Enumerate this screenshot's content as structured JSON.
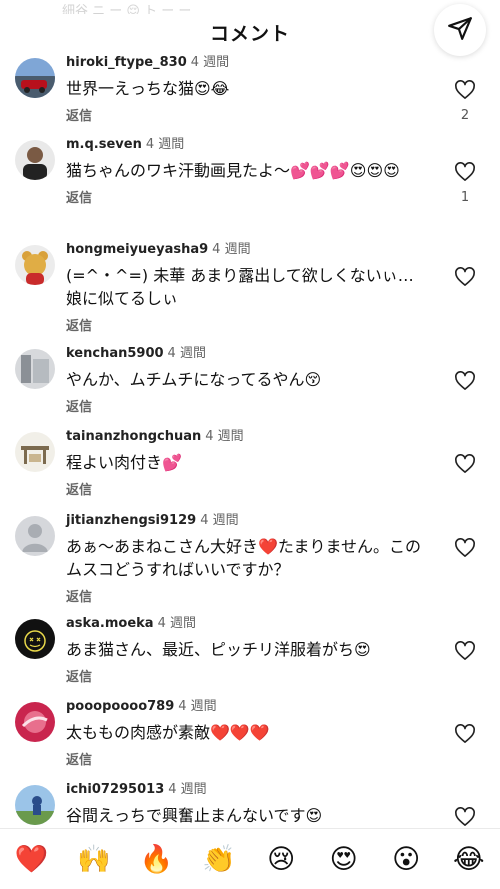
{
  "header": {
    "title": "コメント",
    "ghost_text": "細谷 ニ ー 😌 ト ー ー"
  },
  "comments": [
    {
      "username": "hiroki_ftype_830",
      "time": "4 週間",
      "text": "世界一えっちな猫😍😂",
      "reply": "返信",
      "likes": "2"
    },
    {
      "username": "m.q.seven",
      "time": "4 週間",
      "text": "猫ちゃんのワキ汗動画見たよ〜💕💕💕😍😍😍",
      "reply": "返信",
      "likes": "1"
    },
    {
      "username": "hongmeiyueyasha9",
      "time": "4 週間",
      "text": "(=^・^=) 未華 あまり露出して欲しくないぃ… 娘に似てるしぃ",
      "reply": "返信",
      "likes": ""
    },
    {
      "username": "kenchan5900",
      "time": "4 週間",
      "text": "やんか、ムチムチになってるやん😚",
      "reply": "返信",
      "likes": ""
    },
    {
      "username": "tainanzhongchuan",
      "time": "4 週間",
      "text": "程よい肉付き💕",
      "reply": "返信",
      "likes": ""
    },
    {
      "username": "jitianzhengsi9129",
      "time": "4 週間",
      "text": "あぁ〜あまねこさん大好き❤️たまりません。このムスコどうすればいいですか？",
      "reply": "返信",
      "likes": ""
    },
    {
      "username": "aska.moeka",
      "time": "4 週間",
      "text": "あま猫さん、最近、ピッチリ洋服着がち😍",
      "reply": "返信",
      "likes": ""
    },
    {
      "username": "pooopoooo789",
      "time": "4 週間",
      "text": "太ももの肉感が素敵❤️❤️❤️",
      "reply": "返信",
      "likes": ""
    },
    {
      "username": "ichi07295013",
      "time": "4 週間",
      "text": "谷間えっちで興奮止まんないです😍",
      "reply": "返信",
      "likes": ""
    }
  ],
  "reactions": [
    "❤️",
    "🙌",
    "🔥",
    "👏",
    "😢",
    "😍",
    "😮",
    "😂"
  ],
  "icons": {
    "share": "paper-plane-icon",
    "like": "heart-outline-icon"
  },
  "colors": {
    "text": "#111111",
    "meta": "#666666",
    "heart_stroke": "#222222"
  }
}
